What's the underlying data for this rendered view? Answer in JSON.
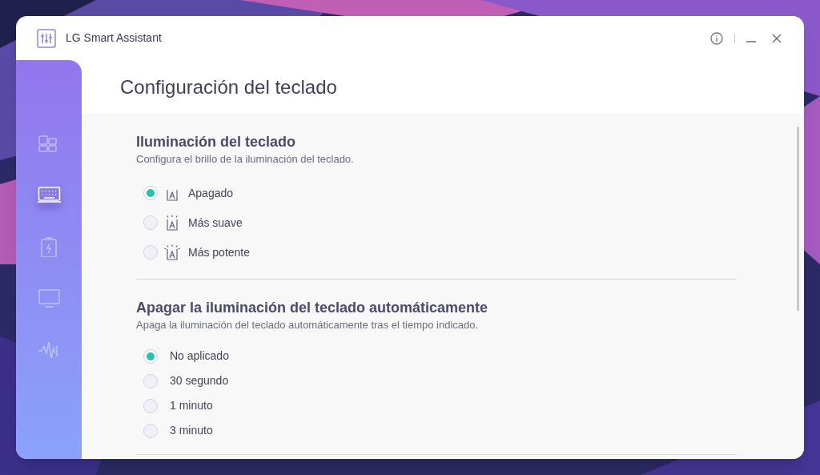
{
  "window": {
    "title": "LG Smart Assistant"
  },
  "sidebar": {
    "items": [
      {
        "kind": "dashboard",
        "selected": false
      },
      {
        "kind": "keyboard",
        "selected": true
      },
      {
        "kind": "battery",
        "selected": false
      },
      {
        "kind": "display",
        "selected": false
      },
      {
        "kind": "audio",
        "selected": false
      }
    ]
  },
  "page_title": "Configuración del teclado",
  "sections": [
    {
      "title": "Iluminación del teclado",
      "description": "Configura el brillo de la iluminación del teclado.",
      "options": [
        {
          "label": "Apagado",
          "kind": "off",
          "selected": true
        },
        {
          "label": "Más suave",
          "kind": "low",
          "selected": false
        },
        {
          "label": "Más potente",
          "kind": "high",
          "selected": false
        }
      ]
    },
    {
      "title": "Apagar la iluminación del teclado automáticamente",
      "description": "Apaga la iluminación del teclado automáticamente tras el tiempo indicado.",
      "options": [
        {
          "label": "No aplicado",
          "selected": true
        },
        {
          "label": "30 segundo",
          "selected": false
        },
        {
          "label": "1 minuto",
          "selected": false
        },
        {
          "label": "3 minuto",
          "selected": false
        }
      ]
    }
  ]
}
